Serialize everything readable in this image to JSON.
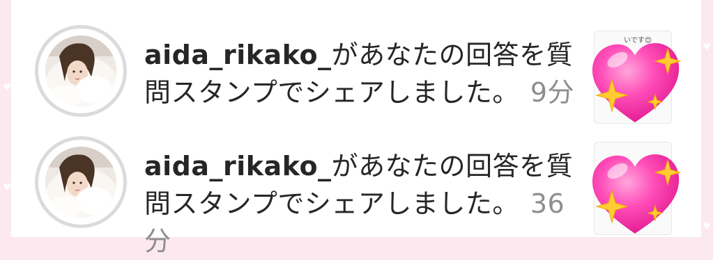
{
  "notifications": [
    {
      "username": "aida_rikako_",
      "message": "があなたの回答を質問スタンプでシェアしました。",
      "time": "9分",
      "thumbnail_icon": "sparkling-heart-icon",
      "thumbnail_caption": "いです😊"
    },
    {
      "username": "aida_rikako_",
      "message": "があなたの回答を質問スタンプでシェアしました。",
      "time": "36分",
      "thumbnail_icon": "sparkling-heart-icon",
      "thumbnail_caption": ""
    }
  ],
  "colors": {
    "background": "#fbe9ef",
    "panel": "#ffffff",
    "text": "#262626",
    "timestamp": "#8e8e8e",
    "avatar_ring": "#dbdbdb",
    "heart": "#ff3fb0",
    "sparkle": "#ffcc33"
  }
}
